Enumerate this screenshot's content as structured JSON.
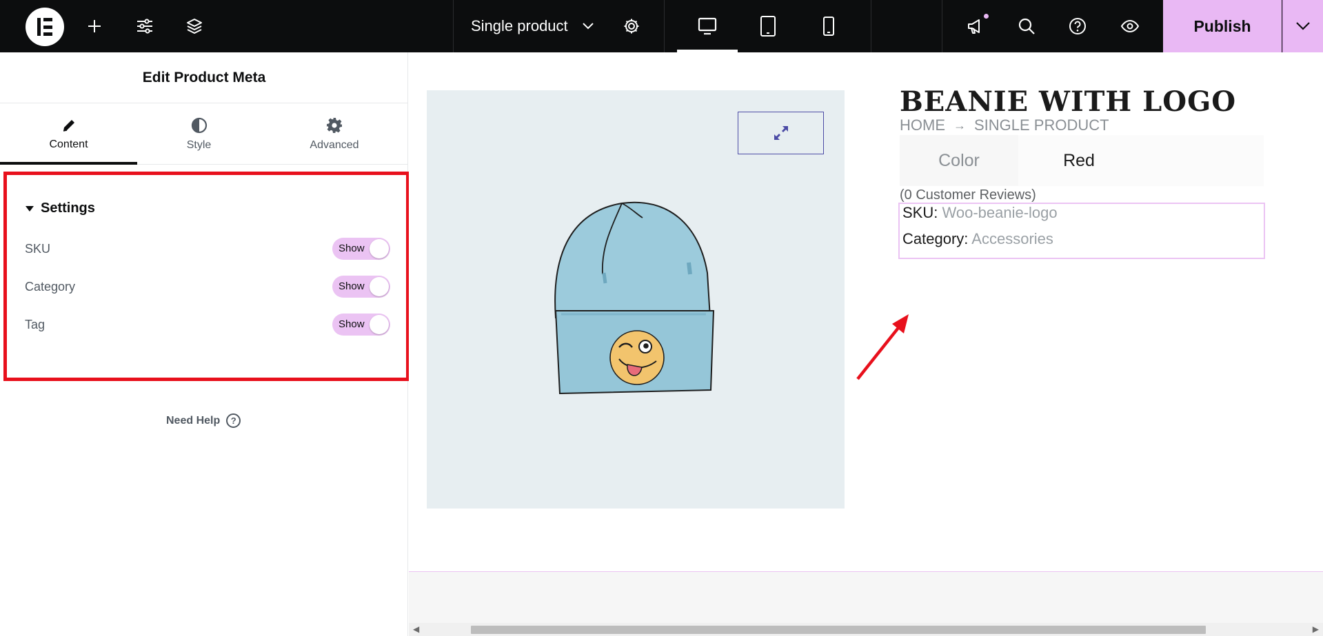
{
  "topbar": {
    "document_title": "Single product",
    "publish_label": "Publish",
    "icons": [
      "elementor-logo-icon",
      "plus-icon",
      "sliders-icon",
      "layers-icon",
      "chevron-down-icon",
      "gear-icon",
      "desktop-icon",
      "tablet-icon",
      "mobile-icon",
      "megaphone-icon",
      "search-icon",
      "help-icon",
      "eye-icon",
      "chevron-down-icon"
    ],
    "accent_color": "#e9b8f4"
  },
  "panel": {
    "title": "Edit Product Meta",
    "tabs": [
      {
        "label": "Content",
        "icon": "pencil-icon",
        "active": true
      },
      {
        "label": "Style",
        "icon": "contrast-icon",
        "active": false
      },
      {
        "label": "Advanced",
        "icon": "gear-icon",
        "active": false
      }
    ],
    "section_title": "Settings",
    "controls": [
      {
        "label": "SKU",
        "toggle": "Show",
        "on": true
      },
      {
        "label": "Category",
        "toggle": "Show",
        "on": true
      },
      {
        "label": "Tag",
        "toggle": "Show",
        "on": true
      }
    ],
    "need_help": "Need Help",
    "highlight_color": "#e8101c"
  },
  "preview": {
    "product_title": "BEANIE WITH LOGO",
    "breadcrumb": [
      "HOME",
      "SINGLE PRODUCT"
    ],
    "attribute": {
      "name": "Color",
      "value": "Red"
    },
    "reviews": "(0 Customer Reviews)",
    "meta": [
      {
        "label": "SKU:",
        "value": "Woo-beanie-logo"
      },
      {
        "label": "Category:",
        "value": "Accessories"
      }
    ]
  }
}
